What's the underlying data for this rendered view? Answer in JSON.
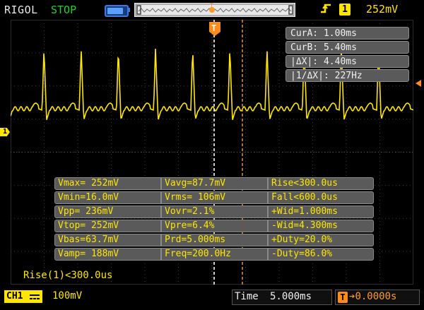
{
  "topbar": {
    "brand": "RIGOL",
    "run_state": "STOP",
    "trigger_edge_symbol": "ꟻ",
    "trigger_channel": "1",
    "trigger_level": "252mV"
  },
  "channel_marker": "1",
  "cursor_panel": {
    "items": [
      "CurA: 1.00ms",
      "CurB: 5.40ms",
      "|ΔX|: 4.40ms",
      "|1/ΔX|: 227Hz"
    ]
  },
  "measurements": {
    "rows": [
      [
        "Vmax= 252mV",
        "Vavg=87.7mV",
        "Rise<300.0us"
      ],
      [
        "Vmin=16.0mV",
        "Vrms= 106mV",
        "Fall<600.0us"
      ],
      [
        "Vpp= 236mV",
        "Vovr=2.1%",
        "+Wid=1.000ms"
      ],
      [
        "Vtop= 252mV",
        "Vpre=6.4%",
        "-Wid=4.300ms"
      ],
      [
        "Vbas=63.7mV",
        "Prd=5.000ms",
        "+Duty=20.0%"
      ],
      [
        "Vamp= 188mV",
        "Freq=200.0Hz",
        "-Duty=86.0%"
      ]
    ]
  },
  "rise_note": "Rise(1)<300.0us",
  "bottombar": {
    "channel_label": "CH1",
    "channel_scale": "100mV",
    "time_label": "Time",
    "time_value": "5.000ms",
    "trigger_offset": "0.0000s"
  },
  "colors": {
    "channel1": "#ffe600",
    "cursor_a": "#ffffff",
    "cursor_b": "#ff9a2a",
    "run_state": "#22d12a",
    "panel_bg": "#5a5a5a"
  },
  "icons": {
    "battery": "battery-icon",
    "trigger_position": "trigger-position-marker",
    "trigger_edge": "rising-edge-icon"
  }
}
